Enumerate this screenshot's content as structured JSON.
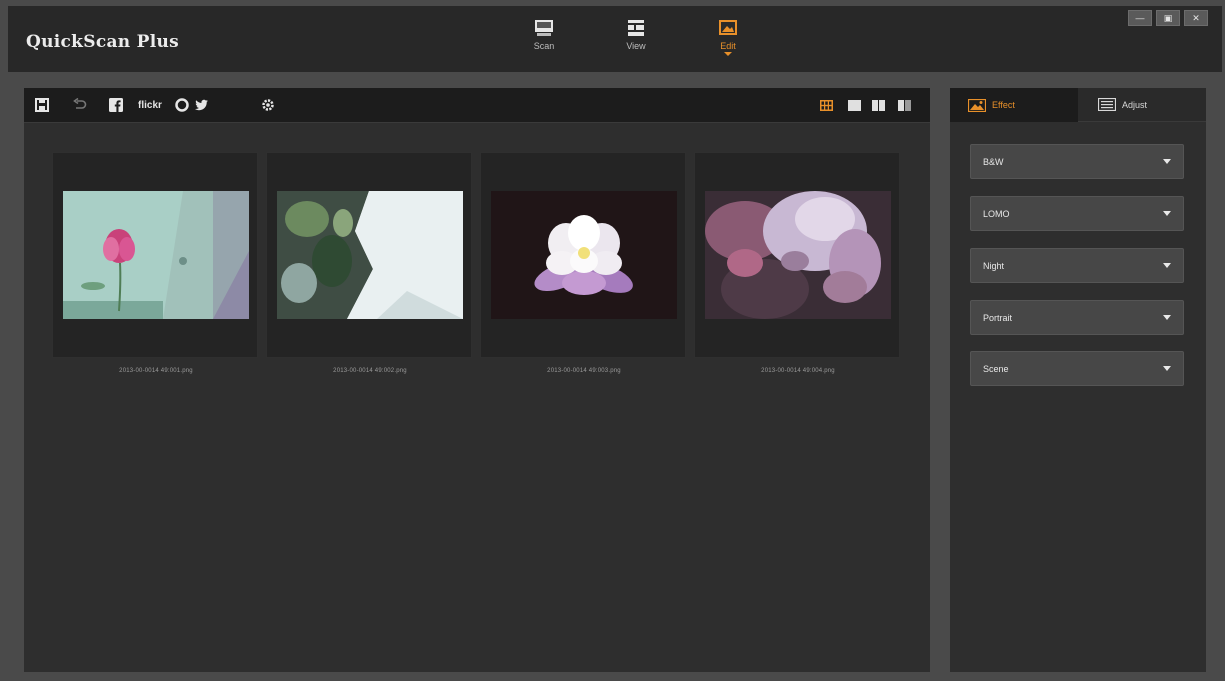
{
  "app": {
    "title": "QuickScan Plus"
  },
  "mode_tabs": [
    {
      "label": "Scan",
      "icon": "scan-icon",
      "active": false
    },
    {
      "label": "View",
      "icon": "view-icon",
      "active": false
    },
    {
      "label": "Edit",
      "icon": "edit-icon",
      "active": true
    }
  ],
  "window_controls": {
    "minimize": "—",
    "maximize": "▣",
    "close": "✕"
  },
  "toolbar": {
    "actions": [
      "save-icon",
      "undo-icon",
      "facebook-icon",
      "flickr-logo",
      "picasa-icon",
      "twitter-icon",
      "settings-icon"
    ],
    "flickr_label": "flickr",
    "view_modes": [
      "grid-view-icon",
      "single-view-icon",
      "compare-view-icon",
      "split-view-icon"
    ]
  },
  "thumbnails": [
    {
      "filename": "2013-00-0014 49:001.png",
      "subject": "pink lotus bud on pale water"
    },
    {
      "filename": "2013-00-0014 49:002.png",
      "subject": "lotus leaves and white light"
    },
    {
      "filename": "2013-00-0014 49:003.png",
      "subject": "white and purple lotus flower"
    },
    {
      "filename": "2013-00-0014 49:004.png",
      "subject": "pale pink lotus petals close-up"
    }
  ],
  "right_panel": {
    "tabs": [
      {
        "label": "Effect",
        "icon": "effect-icon",
        "active": true
      },
      {
        "label": "Adjust",
        "icon": "adjust-icon",
        "active": false
      }
    ],
    "effect_dropdowns": [
      "B&W",
      "LOMO",
      "Night",
      "Portrait",
      "Scene"
    ]
  },
  "colors": {
    "accent": "#e8902a",
    "titlebar_bg": "#282828",
    "panel_bg": "#2e2e2e",
    "toolbar_bg": "#1c1c1c",
    "frame_bg": "#4a4a4a"
  }
}
